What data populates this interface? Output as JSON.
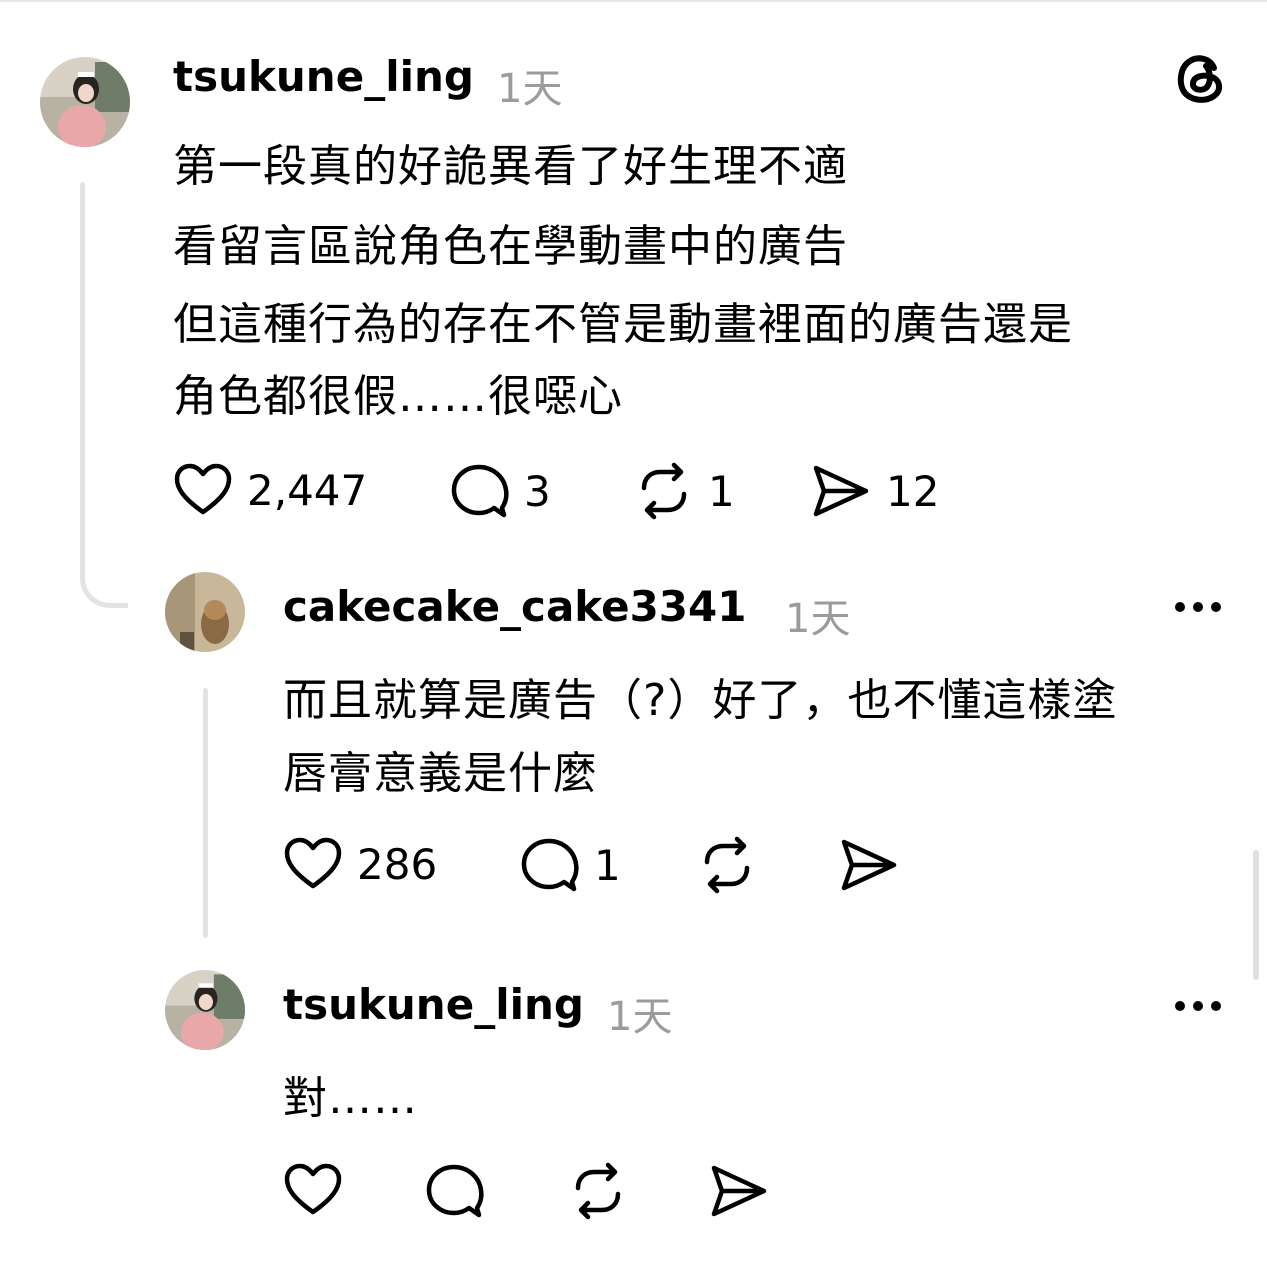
{
  "comment1": {
    "username": "tsukune_ling",
    "time": "1天",
    "lines": [
      "第一段真的好詭異看了好生理不適",
      "看留言區說角色在學動畫中的廣告",
      "但這種行為的存在不管是動畫裡面的廣告還是",
      "角色都很假……很噁心"
    ],
    "likes": "2,447",
    "replies": "3",
    "reposts": "1",
    "shares": "12"
  },
  "comment2": {
    "username": "cakecake_cake3341",
    "time": "1天",
    "lines": [
      "而且就算是廣告（?）好了，也不懂這樣塗",
      "唇膏意義是什麼"
    ],
    "likes": "286",
    "replies": "1"
  },
  "comment3": {
    "username": "tsukune_ling",
    "time": "1天",
    "lines": [
      "對……"
    ]
  },
  "icons": {
    "logo": "threads-logo-icon",
    "like": "heart-icon",
    "reply": "comment-bubble-icon",
    "repost": "repost-icon",
    "share": "send-icon",
    "more": "more-dots-icon"
  },
  "colors": {
    "text": "#000000",
    "muted": "#9b9b9b",
    "thread_line": "#e3e3e3"
  }
}
